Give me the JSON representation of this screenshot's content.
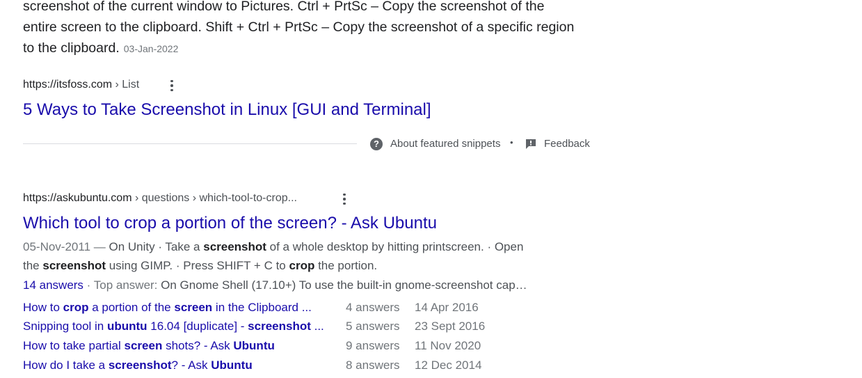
{
  "featured": {
    "snippet_line1": "screenshot of the current window to Pictures. Ctrl + PrtSc – Copy the screenshot of the",
    "snippet_line2": "entire screen to the clipboard. Shift + Ctrl + PrtSc – Copy the screenshot of a specific region",
    "snippet_line3": "to the clipboard.",
    "date": "03-Jan-2022",
    "cite_domain": "https://itsfoss.com",
    "cite_path": " › List",
    "title": "5 Ways to Take Screenshot in Linux [GUI and Terminal]",
    "about_label": "About featured snippets",
    "separator": "•",
    "feedback_label": "Feedback"
  },
  "result": {
    "cite_domain": "https://askubuntu.com",
    "cite_path": " › questions › which-tool-to-crop...",
    "title": "Which tool to crop a portion of the screen? - Ask Ubuntu",
    "date": "05-Nov-2011",
    "date_sep": " — ",
    "s1a": "On Unity · Take a ",
    "s1b": "screenshot",
    "s1c": " of a whole desktop by hitting printscreen. · Open",
    "s2a": "the ",
    "s2b": "screenshot",
    "s2c": " using GIMP. · Press SHIFT + C to ",
    "s2d": "crop",
    "s2e": " the portion.",
    "answers_count": "14 answers",
    "answers_sep": " · ",
    "top_answer_label": "Top answer: ",
    "top_answer_text": "On Gnome Shell (17.10+) To use the built-in gnome-screenshot cap…"
  },
  "related": [
    {
      "parts": [
        "How to ",
        "crop",
        " a portion of the ",
        "screen",
        " in the Clipboard ..."
      ],
      "answers": "4 answers",
      "date": "14 Apr 2016"
    },
    {
      "parts": [
        "Snipping tool in ",
        "ubuntu",
        " 16.04 [duplicate] - ",
        "screenshot",
        " ..."
      ],
      "answers": "5 answers",
      "date": "23 Sept 2016"
    },
    {
      "parts": [
        "How to take partial ",
        "screen",
        " shots? - Ask ",
        "Ubuntu",
        ""
      ],
      "answers": "9 answers",
      "date": "11 Nov 2020"
    },
    {
      "parts": [
        "How do I take a ",
        "screenshot",
        "? - Ask ",
        "Ubuntu",
        ""
      ],
      "answers": "8 answers",
      "date": "12 Dec 2014"
    }
  ]
}
